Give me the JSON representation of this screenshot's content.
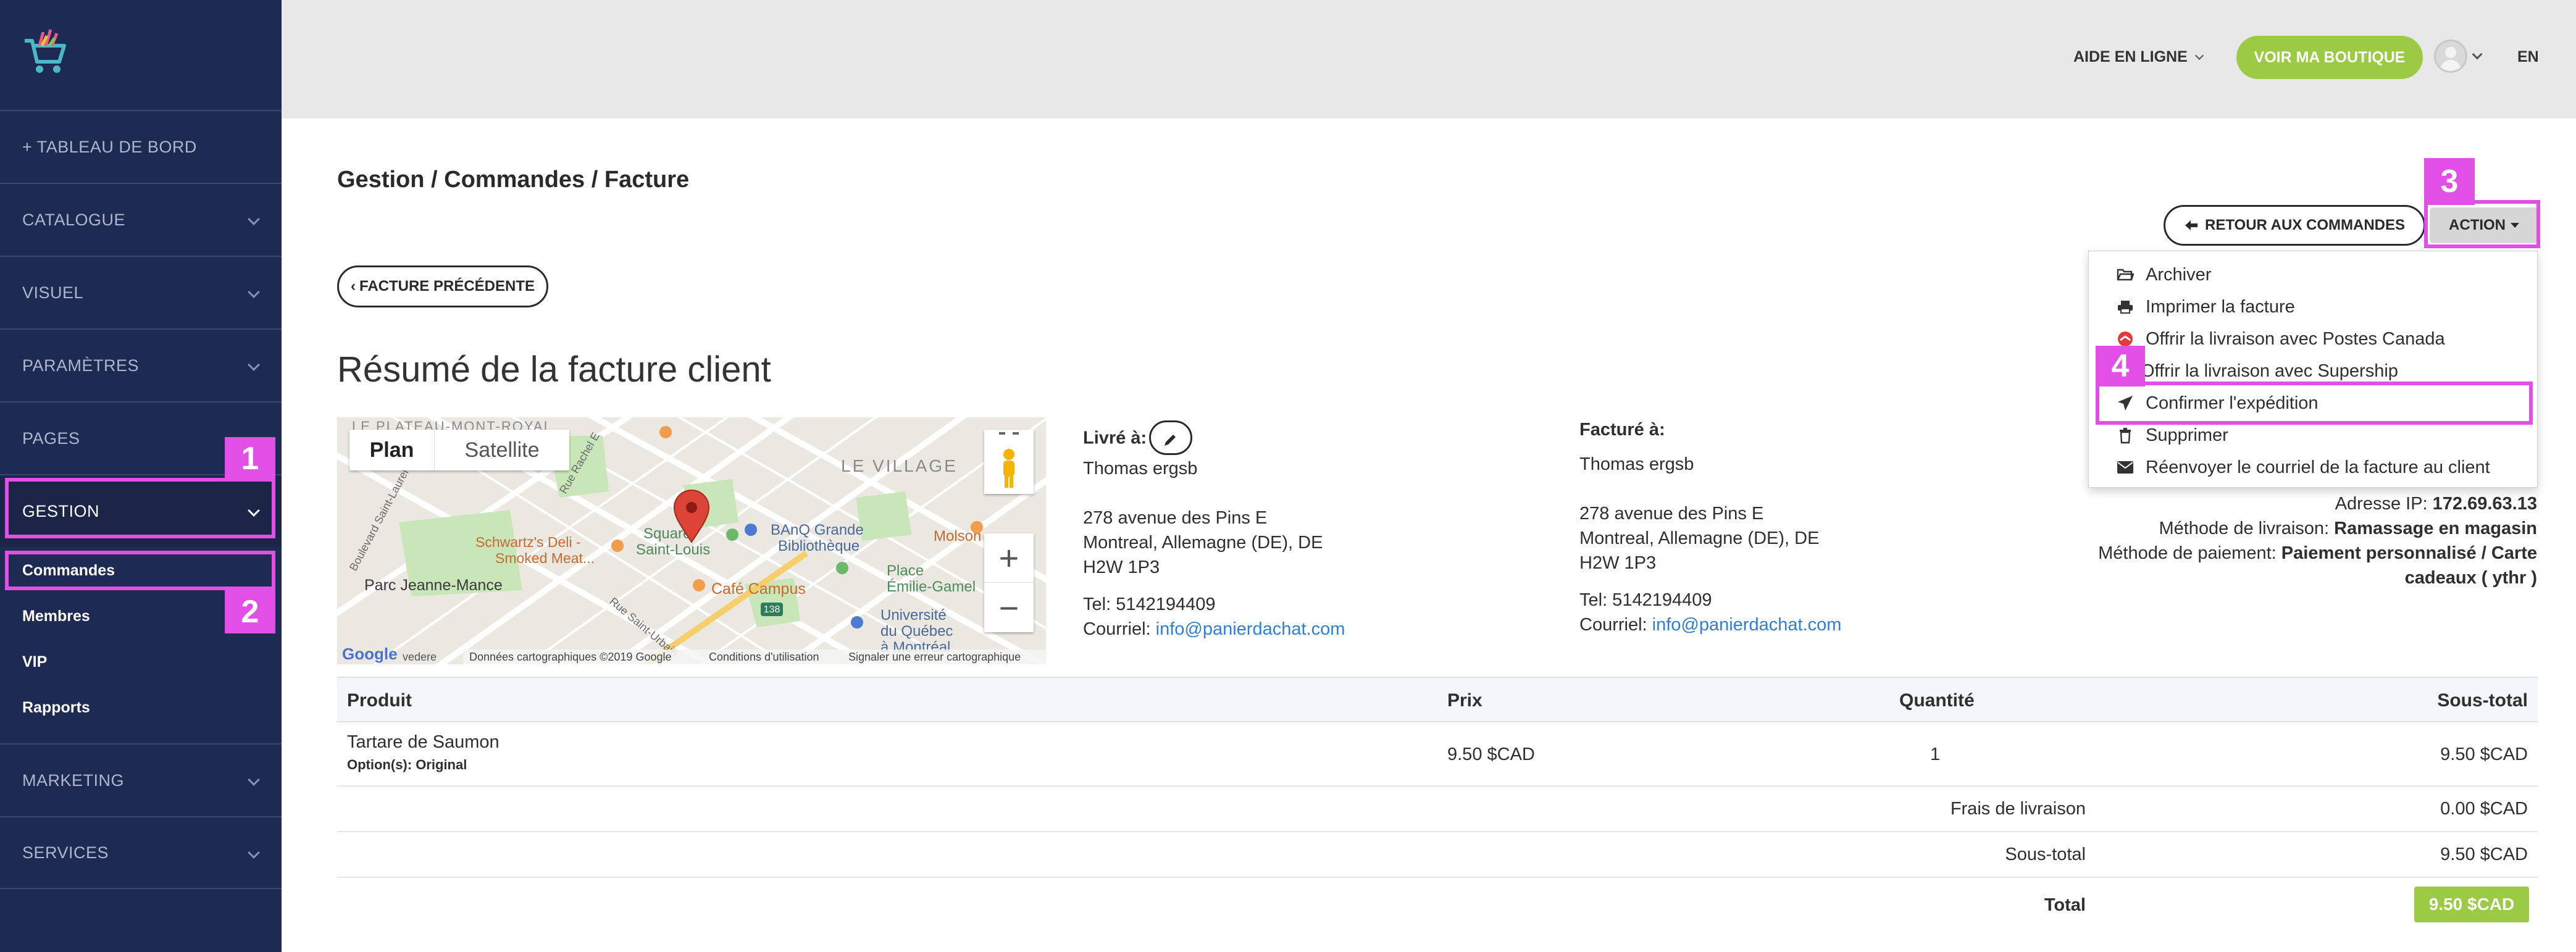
{
  "sidebar": {
    "items": [
      {
        "label": "+ TABLEAU DE BORD"
      },
      {
        "label": "CATALOGUE"
      },
      {
        "label": "VISUEL"
      },
      {
        "label": "PARAMÈTRES"
      },
      {
        "label": "PAGES"
      },
      {
        "label": "GESTION"
      },
      {
        "label": "MARKETING"
      },
      {
        "label": "SERVICES"
      }
    ],
    "gestion_sub": [
      "Commandes",
      "Membres",
      "VIP",
      "Rapports"
    ]
  },
  "annotations": [
    "1",
    "2",
    "3",
    "4"
  ],
  "header": {
    "help": "AIDE EN LIGNE",
    "shop_button": "VOIR MA BOUTIQUE",
    "language": "EN"
  },
  "breadcrumb": "Gestion / Commandes / Facture",
  "buttons": {
    "back_orders": "RETOUR AUX COMMANDES",
    "action": "ACTION",
    "previous_invoice": "FACTURE PRÉCÉDENTE"
  },
  "dropdown": [
    {
      "label": "Archiver",
      "icon": "folder-open-icon"
    },
    {
      "label": "Imprimer la facture",
      "icon": "print-icon"
    },
    {
      "label": "Offrir la livraison avec Postes Canada",
      "icon": "canada-post-icon"
    },
    {
      "label": "Offrir la livraison avec Supership",
      "icon": "supership-icon"
    },
    {
      "label": "Confirmer l'expédition",
      "icon": "paper-plane-icon"
    },
    {
      "label": "Supprimer",
      "icon": "trash-icon"
    },
    {
      "label": "Réenvoyer le courriel de la facture au client",
      "icon": "envelope-icon"
    }
  ],
  "title": "Résumé de la facture client",
  "map": {
    "tab_plan": "Plan",
    "tab_satellite": "Satellite",
    "labels": {
      "plateau": "LE PLATEAU-MONT-ROYAL",
      "village": "LE VILLAGE",
      "square": "Square\nSaint-Louis",
      "banq": "BAnQ Grande\nBibliothèque",
      "schwartz": "Schwartz's Deli -\nSmoked Meat...",
      "parc": "Parc Jeanne-Mance",
      "cafe": "Café Campus",
      "place": "Place\nÉmilie-Gamel",
      "uqam": "Université\ndu Québec\nà Montréal",
      "molson": "Molson",
      "boulevard": "Boulevard Saint-Laurent",
      "rachel": "Rue Rachel E",
      "urbain": "Rue Saint-Urbain",
      "route": "138",
      "vedere": "vedere",
      "google": "Google"
    },
    "footer": [
      "Données cartographiques ©2019 Google",
      "Conditions d'utilisation",
      "Signaler une erreur cartographique"
    ],
    "zoom_in": "+",
    "zoom_out": "−"
  },
  "shipping": {
    "heading": "Livré à:",
    "name": "Thomas ergsb",
    "line1": "278 avenue des Pins E",
    "line2": "Montreal, Allemagne (DE), DE",
    "line3": "H2W 1P3",
    "tel": "Tel: 5142194409",
    "email_label": "Courriel:",
    "email": "info@panierdachat.com"
  },
  "billing": {
    "heading": "Facturé à:",
    "name": "Thomas ergsb",
    "line1": "278 avenue des Pins E",
    "line2": "Montreal, Allemagne (DE), DE",
    "line3": "H2W 1P3",
    "tel": "Tel: 5142194409",
    "email_label": "Courriel:",
    "email": "info@panierdachat.com"
  },
  "meta": {
    "ip_label": "Adresse IP:",
    "ip": "172.69.63.13",
    "delivery_label": "Méthode de livraison:",
    "delivery": "Ramassage en magasin",
    "payment_label": "Méthode de paiement:",
    "payment_a": "Paiement personnalisé / Carte",
    "payment_b": "cadeaux ( ythr )"
  },
  "table": {
    "headers": [
      "Produit",
      "Prix",
      "Quantité",
      "Sous-total"
    ],
    "rows": [
      {
        "product": "Tartare de Saumon",
        "option": "Option(s): Original",
        "price": "9.50 $CAD",
        "qty": "1",
        "subtotal": "9.50 $CAD"
      }
    ],
    "shipping_label": "Frais de livraison",
    "shipping_value": "0.00 $CAD",
    "subtotal_label": "Sous-total",
    "subtotal_value": "9.50 $CAD",
    "total_label": "Total",
    "total_value": "9.50 $CAD"
  },
  "colors": {
    "sidebar": "#1d2a52",
    "accent_green": "#9bcb44",
    "highlight": "#e24fe6",
    "link": "#2f7fd6"
  }
}
